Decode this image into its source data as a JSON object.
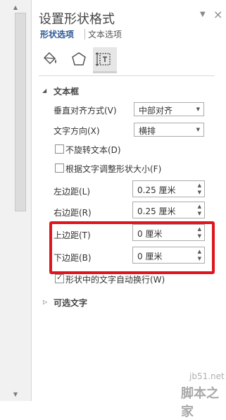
{
  "header": {
    "title": "设置形状格式",
    "pin_icon": "▼",
    "close_icon": "×"
  },
  "tabs": {
    "shape_options": "形状选项",
    "text_options": "文本选项"
  },
  "icons": [
    "fill-bucket-icon",
    "pentagon-icon",
    "textbox-layout-icon"
  ],
  "textbox_section": {
    "title": "文本框",
    "vertical_align_label": "垂直对齐方式(V)",
    "vertical_align_value": "中部对齐",
    "text_direction_label": "文字方向(X)",
    "text_direction_value": "横排",
    "no_rotate_label": "不旋转文本(D)",
    "no_rotate_checked": false,
    "autofit_label": "根据文字调整形状大小(F)",
    "autofit_checked": false,
    "left_margin_label": "左边距(L)",
    "left_margin_value": "0.25 厘米",
    "right_margin_label": "右边距(R)",
    "right_margin_value": "0.25 厘米",
    "top_margin_label": "上边距(T)",
    "top_margin_value": "0 厘米",
    "bottom_margin_label": "下边距(B)",
    "bottom_margin_value": "0 厘米",
    "wrap_label": "形状中的文字自动换行(W)",
    "wrap_checked": true
  },
  "alt_text_section": {
    "title": "可选文字"
  },
  "watermark": {
    "site": "jb51.net",
    "brand": "脚本之家"
  },
  "colors": {
    "accent": "#2b5797",
    "highlight": "#e0141d"
  }
}
